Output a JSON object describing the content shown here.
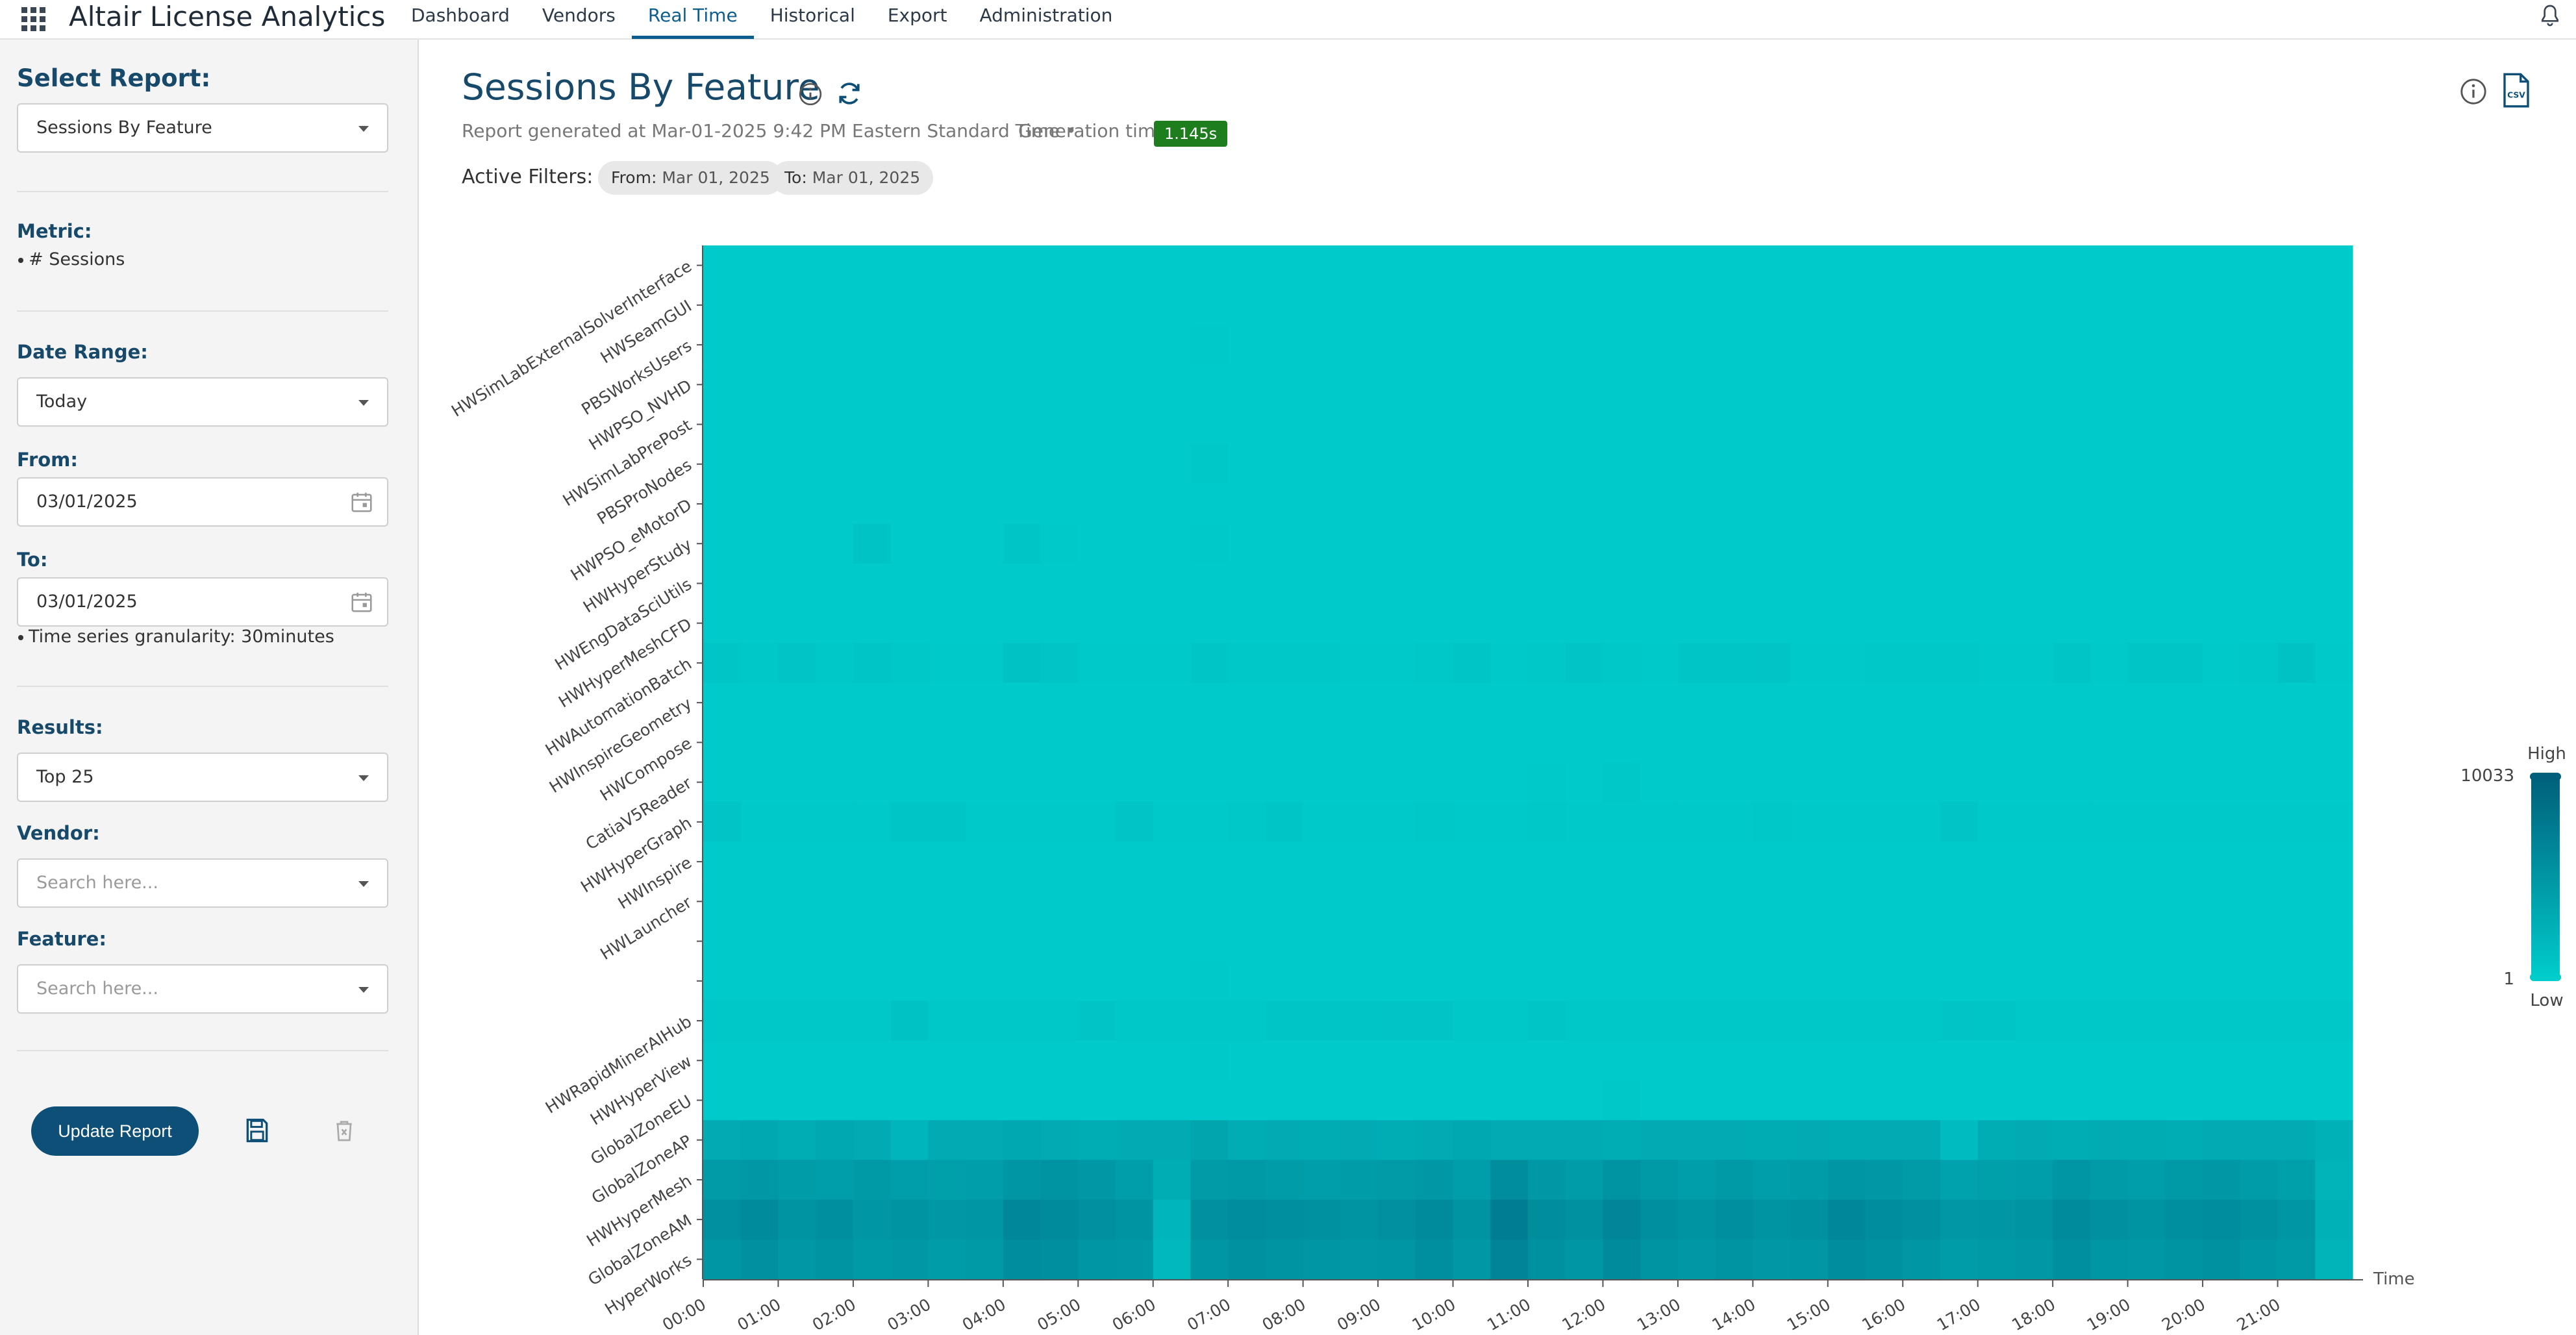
{
  "app": {
    "brand_main": "Altair",
    "brand_sub": "License Analytics"
  },
  "nav": {
    "items": [
      "Dashboard",
      "Vendors",
      "Real Time",
      "Historical",
      "Export",
      "Administration"
    ],
    "active": "Real Time"
  },
  "sidebar": {
    "title": "Select Report:",
    "report_select": "Sessions By Feature",
    "metric_label": "Metric:",
    "metric_value": "# Sessions",
    "date_range_label": "Date Range:",
    "date_range_value": "Today",
    "from_label": "From:",
    "from_value": "03/01/2025",
    "to_label": "To:",
    "to_value": "03/01/2025",
    "granularity": "Time series granularity: 30minutes",
    "results_label": "Results:",
    "results_value": "Top 25",
    "vendor_label": "Vendor:",
    "vendor_placeholder": "Search here...",
    "feature_label": "Feature:",
    "feature_placeholder": "Search here...",
    "update_button": "Update Report"
  },
  "main": {
    "title": "Sessions By Feature",
    "report_generated": "Report generated at Mar-01-2025 9:42 PM Eastern Standard Time  •",
    "generation_time_label": "Generation time",
    "generation_time_value": "1.145s",
    "active_filters_label": "Active Filters:",
    "filter_from_key": "From:",
    "filter_from_value": "Mar 01, 2025",
    "filter_to_key": "To:",
    "filter_to_value": "Mar 01, 2025"
  },
  "colors": {
    "accent": "#0d4f77",
    "title": "#17496a",
    "badge": "#1e7e1e",
    "heat_low": "#00cccc",
    "heat_high": "#005f7a"
  },
  "chart_data": {
    "type": "heatmap",
    "title": "",
    "xlabel": "Time",
    "ylabel": "",
    "x_ticks": [
      "00:00",
      "01:00",
      "02:00",
      "03:00",
      "04:00",
      "05:00",
      "06:00",
      "07:00",
      "08:00",
      "09:00",
      "10:00",
      "11:00",
      "12:00",
      "13:00",
      "14:00",
      "15:00",
      "16:00",
      "17:00",
      "18:00",
      "19:00",
      "20:00",
      "21:00"
    ],
    "x_slots": 44,
    "y_labels": [
      "HWSimLabExternalSolverInterface",
      "HWSeamGUI",
      "PBSWorksUsers",
      "HWPSO_NVHD",
      "HWSimLabPrePost",
      "PBSProNodes",
      "HWPSO_eMotorD",
      "HWHyperStudy",
      "HWEngDataSciUtils",
      "HWHyperMeshCFD",
      "HWAutomationBatch",
      "HWInspireGeometry",
      "HWCompose",
      "CatiaV5Reader",
      "HWHyperGraph",
      "HWInspire",
      "HWLauncher",
      "",
      "",
      "HWRapidMinerAIHub",
      "HWHyperView",
      "GlobalZoneEU",
      "GlobalZoneAP",
      "HWHyperMesh",
      "GlobalZoneAM",
      "HyperWorks"
    ],
    "legend": {
      "max_label": "10033",
      "min_label": "1",
      "high_label": "High",
      "low_label": "Low",
      "max": 10033,
      "min": 1
    },
    "row_intensity_note": "",
    "rows": [
      [
        0.01,
        0.01,
        0.02,
        0.01,
        0.01,
        0.01,
        0.01,
        0.01,
        0.01,
        0.01,
        0.01,
        0.01,
        0.01,
        0.01,
        0.01,
        0.01,
        0.01,
        0.01,
        0.01,
        0.01,
        0.01,
        0.01,
        0.01,
        0.01,
        0.01,
        0.01,
        0.01,
        0.01,
        0.01,
        0.01,
        0.01,
        0.01,
        0.01,
        0.01,
        0.01,
        0.01,
        0.01,
        0.01,
        0.01,
        0.01,
        0.01,
        0.01,
        0.01,
        0.01
      ],
      [
        0.01,
        0.02,
        0.01,
        0.01,
        0.01,
        0.01,
        0.01,
        0.01,
        0.01,
        0.01,
        0.01,
        0.01,
        0.01,
        0.02,
        0.01,
        0.01,
        0.01,
        0.01,
        0.01,
        0.01,
        0.01,
        0.01,
        0.01,
        0.01,
        0.01,
        0.01,
        0.01,
        0.01,
        0.01,
        0.01,
        0.01,
        0.01,
        0.01,
        0.01,
        0.01,
        0.01,
        0.01,
        0.01,
        0.01,
        0.01,
        0.01,
        0.01,
        0.01,
        0.01
      ],
      [
        0.01,
        0.01,
        0.01,
        0.01,
        0.01,
        0.01,
        0.01,
        0.01,
        0.01,
        0.01,
        0.01,
        0.01,
        0.01,
        0.03,
        0.01,
        0.01,
        0.01,
        0.01,
        0.01,
        0.01,
        0.01,
        0.01,
        0.01,
        0.01,
        0.01,
        0.01,
        0.01,
        0.01,
        0.01,
        0.01,
        0.01,
        0.01,
        0.01,
        0.01,
        0.01,
        0.01,
        0.01,
        0.01,
        0.01,
        0.01,
        0.01,
        0.01,
        0.02,
        0.01
      ],
      [
        0.01,
        0.01,
        0.01,
        0.01,
        0.01,
        0.01,
        0.01,
        0.01,
        0.01,
        0.01,
        0.01,
        0.01,
        0.01,
        0.01,
        0.01,
        0.01,
        0.01,
        0.01,
        0.01,
        0.01,
        0.01,
        0.01,
        0.01,
        0.01,
        0.01,
        0.01,
        0.01,
        0.01,
        0.01,
        0.01,
        0.01,
        0.01,
        0.01,
        0.01,
        0.01,
        0.01,
        0.01,
        0.01,
        0.01,
        0.01,
        0.01,
        0.01,
        0.01,
        0.01
      ],
      [
        0.01,
        0.01,
        0.01,
        0.01,
        0.01,
        0.01,
        0.01,
        0.01,
        0.01,
        0.01,
        0.01,
        0.01,
        0.01,
        0.01,
        0.01,
        0.01,
        0.01,
        0.01,
        0.01,
        0.01,
        0.01,
        0.01,
        0.01,
        0.01,
        0.01,
        0.01,
        0.01,
        0.01,
        0.01,
        0.01,
        0.01,
        0.01,
        0.01,
        0.01,
        0.01,
        0.01,
        0.01,
        0.01,
        0.01,
        0.01,
        0.01,
        0.01,
        0.01,
        0.01
      ],
      [
        0.01,
        0.01,
        0.01,
        0.01,
        0.01,
        0.01,
        0.01,
        0.01,
        0.01,
        0.01,
        0.01,
        0.01,
        0.01,
        0.04,
        0.01,
        0.01,
        0.01,
        0.01,
        0.01,
        0.01,
        0.01,
        0.01,
        0.01,
        0.01,
        0.01,
        0.01,
        0.01,
        0.01,
        0.01,
        0.01,
        0.01,
        0.01,
        0.01,
        0.01,
        0.01,
        0.01,
        0.01,
        0.01,
        0.01,
        0.01,
        0.01,
        0.01,
        0.01,
        0.01
      ],
      [
        0.01,
        0.01,
        0.01,
        0.01,
        0.01,
        0.01,
        0.01,
        0.01,
        0.01,
        0.01,
        0.01,
        0.01,
        0.01,
        0.01,
        0.01,
        0.01,
        0.01,
        0.01,
        0.01,
        0.01,
        0.01,
        0.01,
        0.01,
        0.01,
        0.01,
        0.01,
        0.01,
        0.01,
        0.01,
        0.01,
        0.01,
        0.01,
        0.01,
        0.01,
        0.01,
        0.01,
        0.01,
        0.01,
        0.01,
        0.01,
        0.01,
        0.01,
        0.01,
        0.01
      ],
      [
        0.02,
        0.02,
        0.02,
        0.02,
        0.08,
        0.02,
        0.02,
        0.02,
        0.06,
        0.03,
        0.02,
        0.02,
        0.02,
        0.03,
        0.02,
        0.02,
        0.02,
        0.02,
        0.02,
        0.02,
        0.02,
        0.02,
        0.02,
        0.02,
        0.02,
        0.02,
        0.02,
        0.02,
        0.02,
        0.02,
        0.02,
        0.02,
        0.02,
        0.02,
        0.02,
        0.02,
        0.02,
        0.02,
        0.02,
        0.02,
        0.02,
        0.02,
        0.02,
        0.02
      ],
      [
        0.02,
        0.02,
        0.02,
        0.02,
        0.02,
        0.02,
        0.02,
        0.02,
        0.02,
        0.02,
        0.02,
        0.02,
        0.02,
        0.02,
        0.02,
        0.02,
        0.02,
        0.02,
        0.02,
        0.02,
        0.02,
        0.02,
        0.02,
        0.02,
        0.02,
        0.02,
        0.02,
        0.02,
        0.02,
        0.02,
        0.02,
        0.02,
        0.02,
        0.02,
        0.02,
        0.02,
        0.02,
        0.02,
        0.02,
        0.02,
        0.02,
        0.02,
        0.02,
        0.02
      ],
      [
        0.02,
        0.02,
        0.02,
        0.02,
        0.02,
        0.02,
        0.02,
        0.02,
        0.02,
        0.02,
        0.02,
        0.02,
        0.02,
        0.02,
        0.02,
        0.02,
        0.02,
        0.02,
        0.02,
        0.02,
        0.02,
        0.02,
        0.02,
        0.02,
        0.02,
        0.02,
        0.02,
        0.02,
        0.02,
        0.02,
        0.02,
        0.02,
        0.02,
        0.02,
        0.02,
        0.02,
        0.02,
        0.02,
        0.02,
        0.02,
        0.02,
        0.02,
        0.02,
        0.02
      ],
      [
        0.06,
        0.05,
        0.07,
        0.05,
        0.06,
        0.05,
        0.03,
        0.03,
        0.1,
        0.07,
        0.03,
        0.03,
        0.03,
        0.06,
        0.05,
        0.05,
        0.04,
        0.03,
        0.03,
        0.05,
        0.06,
        0.03,
        0.05,
        0.07,
        0.04,
        0.03,
        0.06,
        0.06,
        0.07,
        0.03,
        0.03,
        0.05,
        0.04,
        0.04,
        0.03,
        0.03,
        0.06,
        0.03,
        0.06,
        0.06,
        0.03,
        0.04,
        0.09,
        0.03
      ],
      [
        0.01,
        0.01,
        0.01,
        0.01,
        0.01,
        0.01,
        0.01,
        0.01,
        0.01,
        0.01,
        0.01,
        0.01,
        0.01,
        0.01,
        0.01,
        0.01,
        0.01,
        0.01,
        0.01,
        0.01,
        0.01,
        0.01,
        0.01,
        0.01,
        0.01,
        0.01,
        0.01,
        0.01,
        0.01,
        0.01,
        0.01,
        0.01,
        0.01,
        0.01,
        0.01,
        0.01,
        0.01,
        0.01,
        0.01,
        0.01,
        0.01,
        0.01,
        0.01,
        0.01
      ],
      [
        0.01,
        0.01,
        0.01,
        0.01,
        0.01,
        0.01,
        0.01,
        0.01,
        0.01,
        0.01,
        0.01,
        0.01,
        0.01,
        0.01,
        0.01,
        0.01,
        0.01,
        0.01,
        0.01,
        0.01,
        0.01,
        0.01,
        0.01,
        0.01,
        0.01,
        0.01,
        0.01,
        0.01,
        0.01,
        0.01,
        0.01,
        0.01,
        0.01,
        0.01,
        0.01,
        0.01,
        0.01,
        0.01,
        0.01,
        0.01,
        0.01,
        0.01,
        0.01,
        0.01
      ],
      [
        0.02,
        0.02,
        0.02,
        0.02,
        0.02,
        0.02,
        0.02,
        0.02,
        0.02,
        0.02,
        0.02,
        0.02,
        0.02,
        0.02,
        0.02,
        0.02,
        0.02,
        0.02,
        0.02,
        0.02,
        0.02,
        0.02,
        0.03,
        0.02,
        0.04,
        0.02,
        0.02,
        0.02,
        0.02,
        0.02,
        0.02,
        0.02,
        0.02,
        0.02,
        0.02,
        0.02,
        0.02,
        0.02,
        0.02,
        0.02,
        0.02,
        0.02,
        0.02,
        0.02
      ],
      [
        0.07,
        0.03,
        0.03,
        0.03,
        0.03,
        0.06,
        0.06,
        0.03,
        0.03,
        0.03,
        0.03,
        0.07,
        0.03,
        0.03,
        0.04,
        0.06,
        0.03,
        0.03,
        0.03,
        0.04,
        0.03,
        0.03,
        0.05,
        0.03,
        0.03,
        0.03,
        0.03,
        0.03,
        0.04,
        0.03,
        0.03,
        0.03,
        0.03,
        0.07,
        0.03,
        0.03,
        0.03,
        0.03,
        0.03,
        0.03,
        0.03,
        0.03,
        0.03,
        0.03
      ],
      [
        0.01,
        0.01,
        0.01,
        0.01,
        0.01,
        0.01,
        0.01,
        0.01,
        0.01,
        0.01,
        0.01,
        0.01,
        0.01,
        0.01,
        0.01,
        0.01,
        0.01,
        0.01,
        0.01,
        0.01,
        0.01,
        0.01,
        0.01,
        0.01,
        0.01,
        0.01,
        0.01,
        0.01,
        0.01,
        0.01,
        0.01,
        0.01,
        0.01,
        0.01,
        0.01,
        0.01,
        0.01,
        0.01,
        0.01,
        0.01,
        0.01,
        0.01,
        0.01,
        0.01
      ],
      [
        0.01,
        0.01,
        0.01,
        0.01,
        0.01,
        0.01,
        0.01,
        0.01,
        0.01,
        0.01,
        0.01,
        0.01,
        0.01,
        0.01,
        0.01,
        0.01,
        0.01,
        0.01,
        0.01,
        0.01,
        0.01,
        0.01,
        0.01,
        0.01,
        0.01,
        0.01,
        0.01,
        0.01,
        0.01,
        0.01,
        0.01,
        0.01,
        0.01,
        0.01,
        0.01,
        0.01,
        0.01,
        0.01,
        0.01,
        0.01,
        0.01,
        0.01,
        0.01,
        0.01
      ],
      [
        0.01,
        0.01,
        0.01,
        0.01,
        0.01,
        0.01,
        0.01,
        0.01,
        0.01,
        0.01,
        0.01,
        0.01,
        0.01,
        0.01,
        0.01,
        0.01,
        0.01,
        0.01,
        0.01,
        0.01,
        0.01,
        0.01,
        0.01,
        0.01,
        0.01,
        0.01,
        0.01,
        0.01,
        0.01,
        0.01,
        0.01,
        0.01,
        0.01,
        0.01,
        0.01,
        0.01,
        0.01,
        0.01,
        0.01,
        0.01,
        0.01,
        0.01,
        0.01,
        0.01
      ],
      [
        0.01,
        0.01,
        0.01,
        0.01,
        0.01,
        0.01,
        0.01,
        0.01,
        0.01,
        0.01,
        0.01,
        0.01,
        0.01,
        0.03,
        0.01,
        0.01,
        0.01,
        0.01,
        0.01,
        0.01,
        0.01,
        0.01,
        0.01,
        0.01,
        0.01,
        0.01,
        0.01,
        0.01,
        0.01,
        0.01,
        0.01,
        0.01,
        0.01,
        0.01,
        0.01,
        0.01,
        0.01,
        0.01,
        0.01,
        0.01,
        0.01,
        0.01,
        0.01,
        0.01
      ],
      [
        0.05,
        0.04,
        0.04,
        0.04,
        0.04,
        0.1,
        0.04,
        0.04,
        0.04,
        0.04,
        0.07,
        0.04,
        0.04,
        0.05,
        0.05,
        0.06,
        0.06,
        0.06,
        0.07,
        0.07,
        0.04,
        0.04,
        0.06,
        0.04,
        0.04,
        0.05,
        0.04,
        0.04,
        0.04,
        0.04,
        0.04,
        0.04,
        0.04,
        0.07,
        0.06,
        0.04,
        0.04,
        0.05,
        0.04,
        0.04,
        0.04,
        0.04,
        0.04,
        0.04
      ],
      [
        0.02,
        0.02,
        0.02,
        0.02,
        0.02,
        0.02,
        0.02,
        0.02,
        0.02,
        0.02,
        0.02,
        0.02,
        0.02,
        0.03,
        0.02,
        0.02,
        0.02,
        0.02,
        0.02,
        0.02,
        0.02,
        0.02,
        0.02,
        0.02,
        0.02,
        0.02,
        0.02,
        0.02,
        0.02,
        0.02,
        0.02,
        0.02,
        0.02,
        0.02,
        0.02,
        0.02,
        0.02,
        0.02,
        0.02,
        0.02,
        0.02,
        0.02,
        0.02,
        0.02
      ],
      [
        0.02,
        0.02,
        0.02,
        0.02,
        0.02,
        0.02,
        0.02,
        0.02,
        0.02,
        0.02,
        0.02,
        0.02,
        0.02,
        0.02,
        0.02,
        0.02,
        0.02,
        0.02,
        0.02,
        0.02,
        0.02,
        0.02,
        0.02,
        0.02,
        0.04,
        0.02,
        0.02,
        0.02,
        0.02,
        0.02,
        0.02,
        0.02,
        0.02,
        0.02,
        0.02,
        0.02,
        0.02,
        0.02,
        0.02,
        0.02,
        0.02,
        0.02,
        0.02,
        0.02
      ],
      [
        0.3,
        0.32,
        0.28,
        0.33,
        0.3,
        0.2,
        0.3,
        0.3,
        0.33,
        0.3,
        0.28,
        0.3,
        0.3,
        0.36,
        0.28,
        0.3,
        0.29,
        0.3,
        0.28,
        0.3,
        0.32,
        0.3,
        0.3,
        0.3,
        0.28,
        0.3,
        0.3,
        0.3,
        0.29,
        0.3,
        0.29,
        0.3,
        0.3,
        0.15,
        0.28,
        0.3,
        0.28,
        0.3,
        0.29,
        0.28,
        0.3,
        0.3,
        0.3,
        0.24
      ],
      [
        0.45,
        0.48,
        0.44,
        0.42,
        0.46,
        0.42,
        0.4,
        0.42,
        0.5,
        0.52,
        0.48,
        0.42,
        0.28,
        0.45,
        0.46,
        0.44,
        0.42,
        0.43,
        0.45,
        0.48,
        0.42,
        0.58,
        0.48,
        0.44,
        0.52,
        0.46,
        0.42,
        0.46,
        0.42,
        0.43,
        0.5,
        0.48,
        0.45,
        0.38,
        0.4,
        0.42,
        0.5,
        0.45,
        0.42,
        0.46,
        0.48,
        0.44,
        0.4,
        0.22
      ],
      [
        0.55,
        0.6,
        0.52,
        0.56,
        0.5,
        0.52,
        0.48,
        0.5,
        0.62,
        0.6,
        0.55,
        0.52,
        0.2,
        0.55,
        0.58,
        0.56,
        0.54,
        0.52,
        0.55,
        0.6,
        0.52,
        0.72,
        0.58,
        0.54,
        0.64,
        0.56,
        0.52,
        0.56,
        0.52,
        0.54,
        0.62,
        0.58,
        0.55,
        0.48,
        0.5,
        0.52,
        0.6,
        0.55,
        0.52,
        0.56,
        0.58,
        0.54,
        0.5,
        0.24
      ],
      [
        0.5,
        0.55,
        0.48,
        0.52,
        0.46,
        0.48,
        0.44,
        0.46,
        0.58,
        0.56,
        0.5,
        0.48,
        0.18,
        0.5,
        0.54,
        0.52,
        0.5,
        0.48,
        0.5,
        0.56,
        0.48,
        0.66,
        0.54,
        0.5,
        0.6,
        0.52,
        0.48,
        0.52,
        0.48,
        0.5,
        0.58,
        0.54,
        0.5,
        0.44,
        0.46,
        0.48,
        0.56,
        0.5,
        0.48,
        0.52,
        0.54,
        0.5,
        0.46,
        0.22
      ]
    ]
  }
}
